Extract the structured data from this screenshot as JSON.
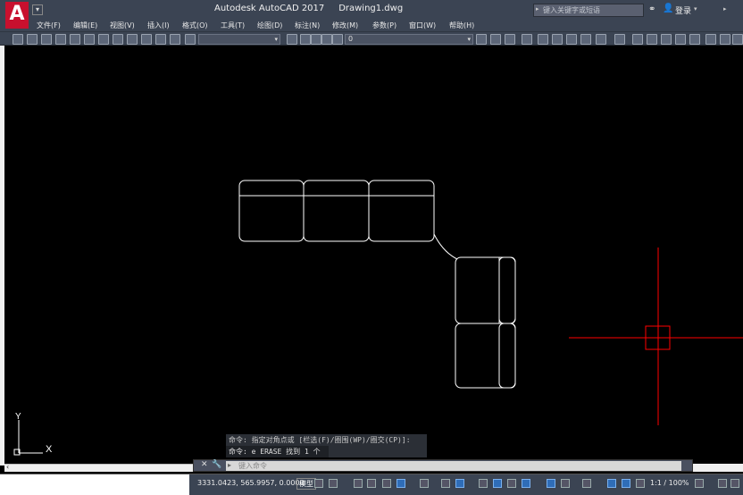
{
  "app": {
    "logo_letter": "A",
    "title": "Autodesk AutoCAD 2017",
    "document": "Drawing1.dwg",
    "search_placeholder": "键入关键字或短语",
    "login_label": "登录"
  },
  "menu": {
    "items": [
      "文件(F)",
      "编辑(E)",
      "视图(V)",
      "插入(I)",
      "格式(O)",
      "工具(T)",
      "绘图(D)",
      "标注(N)",
      "修改(M)",
      "参数(P)",
      "窗口(W)",
      "帮助(H)"
    ]
  },
  "toolbar": {
    "layer_value": "0"
  },
  "canvas": {
    "ucs_x_label": "X",
    "ucs_y_label": "Y",
    "line_color": "#ffffff",
    "crosshair_color": "#ff0000"
  },
  "command": {
    "history": [
      "命令: 指定对角点或 [栏选(F)/圈围(WP)/圈交(CP)]:",
      "命令: e ERASE 找到 1 个"
    ],
    "placeholder": "键入命令"
  },
  "status": {
    "coordinates": "3331.0423, 565.9957, 0.0000",
    "model_tab": "模型",
    "annotation_scale": "1:1 / 100%"
  },
  "colors": {
    "chrome": "#3b4453",
    "canvas": "#000000"
  }
}
